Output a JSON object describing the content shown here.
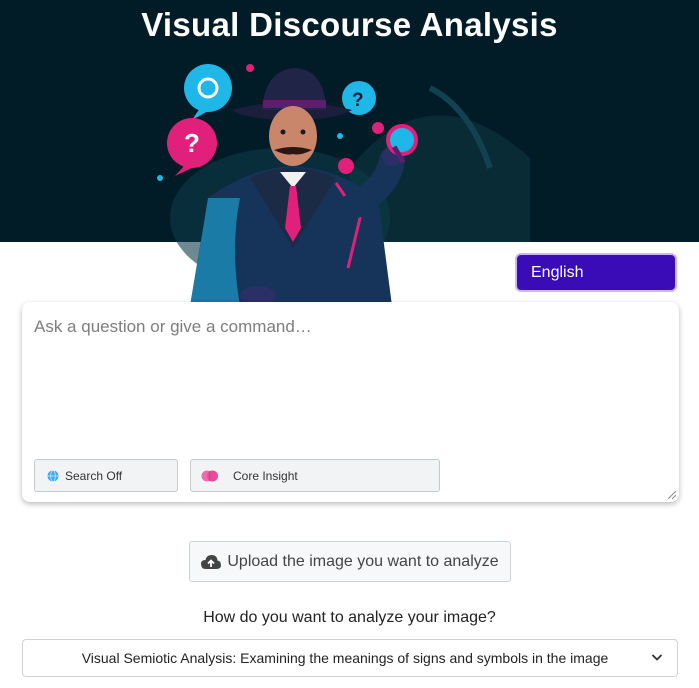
{
  "app": {
    "title": "Visual Discourse Analysis"
  },
  "language": {
    "selected": "English"
  },
  "prompt": {
    "placeholder": "Ask a question or give a command…",
    "value": ""
  },
  "chips": {
    "search": {
      "label": "Search Off",
      "icon": "globe-icon"
    },
    "mode": {
      "label": "Core Insight",
      "icon": "brain-icon"
    }
  },
  "upload": {
    "label": "Upload the image you want to analyze",
    "icon": "cloud-upload-icon"
  },
  "analysis": {
    "question": "How do you want to analyze your image?",
    "selected": "Visual Semiotic Analysis: Examining the meanings of signs and symbols in the image"
  },
  "colors": {
    "hero_background": "#021c27",
    "language_button": "#3a0cb8",
    "accent_pink": "#e0207a",
    "accent_cyan": "#1fb6e8"
  }
}
